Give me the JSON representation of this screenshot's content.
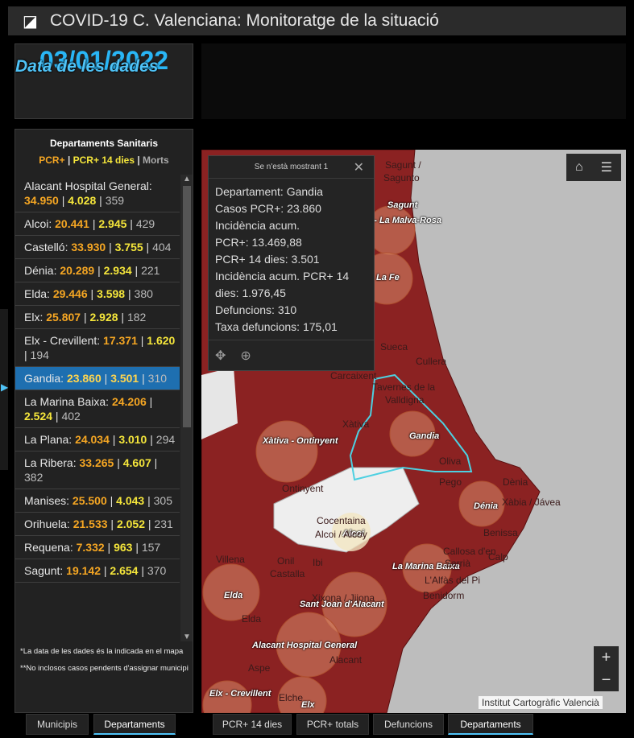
{
  "app": {
    "title": "COVID-19 C. Valenciana: Monitoratge de la situació",
    "logo_icon": "chart-logo-icon"
  },
  "date": {
    "label": "Data de les dades",
    "value": "03/01/2022"
  },
  "list": {
    "title": "Departaments Sanitaris",
    "legend": {
      "a": "PCR+",
      "b": "PCR+ 14 dies",
      "c": "Morts"
    },
    "items": [
      {
        "name": "Alacant Hospital General:",
        "a": "34.950",
        "b": "4.028",
        "c": "359"
      },
      {
        "name": "Alcoi:",
        "a": "20.441",
        "b": "2.945",
        "c": "429"
      },
      {
        "name": "Castelló:",
        "a": "33.930",
        "b": "3.755",
        "c": "404"
      },
      {
        "name": "Dénia:",
        "a": "20.289",
        "b": "2.934",
        "c": "221"
      },
      {
        "name": "Elda:",
        "a": "29.446",
        "b": "3.598",
        "c": "380"
      },
      {
        "name": "Elx:",
        "a": "25.807",
        "b": "2.928",
        "c": "182"
      },
      {
        "name": "Elx - Crevillent:",
        "a": "17.371",
        "b": "1.620",
        "c": "194"
      },
      {
        "name": "Gandia:",
        "a": "23.860",
        "b": "3.501",
        "c": "310"
      },
      {
        "name": "La Marina Baixa:",
        "a": "24.206",
        "b": "2.524",
        "c": "402"
      },
      {
        "name": "La Plana:",
        "a": "24.034",
        "b": "3.010",
        "c": "294"
      },
      {
        "name": "La Ribera:",
        "a": "33.265",
        "b": "4.607",
        "c": "382"
      },
      {
        "name": "Manises:",
        "a": "25.500",
        "b": "4.043",
        "c": "305"
      },
      {
        "name": "Orihuela:",
        "a": "21.533",
        "b": "2.052",
        "c": "231"
      },
      {
        "name": "Requena:",
        "a": "7.332",
        "b": "963",
        "c": "157"
      },
      {
        "name": "Sagunt:",
        "a": "19.142",
        "b": "2.654",
        "c": "370"
      }
    ],
    "selected": "Gandia:",
    "note1": "*La data de les dades és la indicada en el mapa",
    "note2": "**No inclosos casos pendents d'assignar municipi"
  },
  "left_tabs": [
    "Municipis",
    "Departaments"
  ],
  "map_tabs": [
    "PCR+ 14 dies",
    "PCR+ totals",
    "Defuncions",
    "Departaments"
  ],
  "popup": {
    "header": "Se n'està mostrant 1",
    "lines": [
      "Departament: Gandia",
      "Casos PCR+: 23.860",
      "Incidència acum.",
      "PCR+: 13.469,88",
      "PCR+ 14 dies: 3.501",
      "Incidència acum. PCR+ 14",
      "dies: 1.976,45",
      "Defuncions: 310",
      "Taxa defuncions: 175,01"
    ]
  },
  "map": {
    "attribution": "Institut Cartogràfic Valencià",
    "labels": [
      "Sagunt",
      "ic - La Malva-Rosa",
      "La Fe",
      "Xàtiva - Ontinyent",
      "Gandia",
      "Dénia",
      "Alcoi",
      "La Marina Baixa",
      "Elda",
      "Sant Joan d'Alacant",
      "Alacant Hospital General",
      "Elx - Crevillent",
      "Elx"
    ],
    "towns": [
      "Sagunt /",
      "Sagunto",
      "Sueca",
      "Cullera",
      "Carcaixent",
      "Tavernes de la",
      "Valldigna",
      "Xàtiva",
      "Oliva",
      "Pego",
      "Dènia",
      "Xàbia / Jávea",
      "Ontinyent",
      "Cocentaina",
      "Alcoi / Alcoy",
      "Benissa",
      "Calp",
      "Villena",
      "Onil",
      "Castalla",
      "Ibi",
      "Callosa d'en",
      "Sarrià",
      "L'Alfàs del Pi",
      "Benidorm",
      "Xixona / Jijona",
      "Elda",
      "Aspe",
      "Alacant",
      "Elche"
    ],
    "zoom_in": "+",
    "zoom_out": "−"
  },
  "colors": {
    "accent": "#29b6f6",
    "pcr": "#f5a623",
    "pcr14": "#f5e63b",
    "region": "#8b2222"
  }
}
